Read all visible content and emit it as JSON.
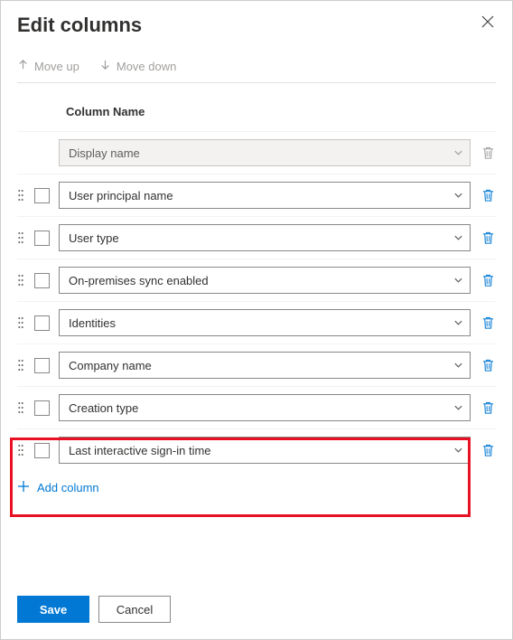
{
  "title": "Edit columns",
  "toolbar": {
    "move_up": "Move up",
    "move_down": "Move down"
  },
  "header": {
    "column_name": "Column Name"
  },
  "rows": [
    {
      "label": "Display name",
      "disabled": true,
      "checkable": false
    },
    {
      "label": "User principal name",
      "disabled": false,
      "checkable": true
    },
    {
      "label": "User type",
      "disabled": false,
      "checkable": true
    },
    {
      "label": "On-premises sync enabled",
      "disabled": false,
      "checkable": true
    },
    {
      "label": "Identities",
      "disabled": false,
      "checkable": true
    },
    {
      "label": "Company name",
      "disabled": false,
      "checkable": true
    },
    {
      "label": "Creation type",
      "disabled": false,
      "checkable": true
    },
    {
      "label": "Last interactive sign-in time",
      "disabled": false,
      "checkable": true
    }
  ],
  "add_label": "Add column",
  "footer": {
    "save": "Save",
    "cancel": "Cancel"
  }
}
